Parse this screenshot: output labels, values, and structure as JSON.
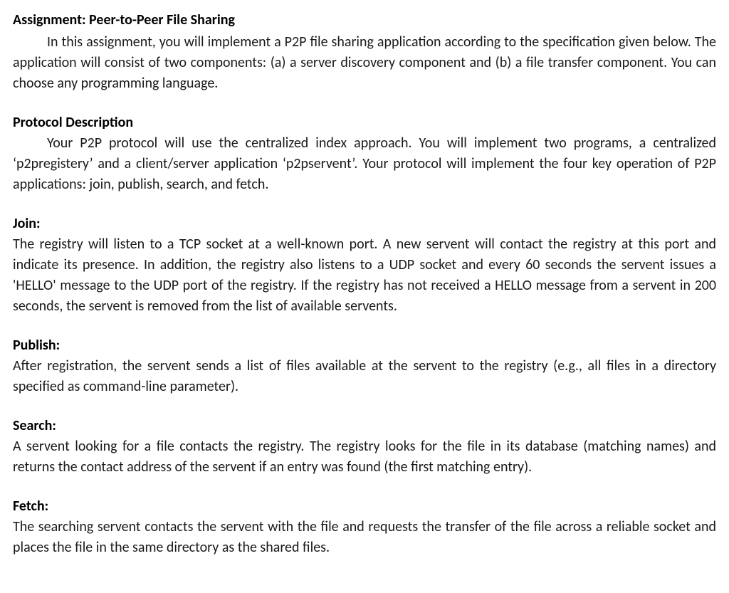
{
  "assignment": {
    "title": "Assignment: Peer-to-Peer File Sharing",
    "intro": "In this assignment, you will implement a P2P file sharing application according to the specification given below. The application will consist of two components: (a) a server discovery component and (b) a file transfer component. You can choose any programming language."
  },
  "protocol": {
    "heading": "Protocol Description",
    "body": "Your P2P protocol will use the centralized index approach. You will implement two programs, a centralized ‘p2pregistery’ and a client/server application ‘p2pservent’. Your protocol will implement the four key operation of P2P applications: join, publish, search, and fetch."
  },
  "join": {
    "heading": "Join:",
    "body": "The registry will listen to a TCP socket at a well-known port. A new servent will contact the registry at this port and indicate its presence. In addition, the registry also listens to a UDP socket and every 60 seconds the servent issues a 'HELLO' message to the UDP port of the registry. If the registry has not received a HELLO message from a servent in 200 seconds, the servent is removed from the list of available servents."
  },
  "publish": {
    "heading": "Publish:",
    "body": "After registration, the servent sends a list of files available at the servent to the registry (e.g., all files in a directory specified as command-line parameter)."
  },
  "search": {
    "heading": "Search:",
    "body": "A servent looking for a file contacts the registry. The registry looks for the file in its database (matching names) and returns the contact address of the servent if an entry was found (the first matching entry)."
  },
  "fetch": {
    "heading": "Fetch:",
    "body": "The searching servent contacts the servent with the file and requests the transfer of the file across a reliable socket and places the file in the same directory as the shared files."
  }
}
